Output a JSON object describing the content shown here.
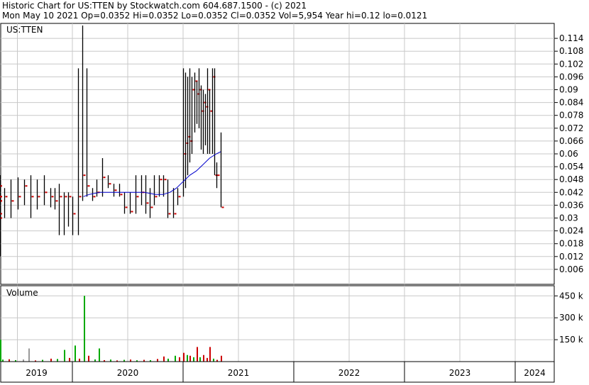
{
  "header": {
    "line1": "Historic Chart for US:TTEN by Stockwatch.com 604.687.1500 - (c) 2021",
    "line2": "Mon May 10 2021   Op=0.0352  Hi=0.0352  Lo=0.0352  Cl=0.0352  Vol=5,954  Year hi=0.12  lo=0.0121"
  },
  "price_panel": {
    "symbol_label": "US:TTEN"
  },
  "volume_panel": {
    "label": "Volume"
  },
  "colors": {
    "price_bar": "#000000",
    "close_tick": "#cc0000",
    "ma_short": "#cc33cc",
    "ma_long": "#0000cc",
    "vol_up": "#00aa00",
    "vol_down": "#cc0000",
    "vol_flat": "#999999",
    "grid": "#c8c8c8"
  },
  "chart_data": [
    {
      "type": "bar",
      "title": "Historic Chart for US:TTEN",
      "series_label": "US:TTEN",
      "ylim": [
        0,
        0.12
      ],
      "y_ticks": [
        "0.114",
        "0.108",
        "0.102",
        "0.096",
        "0.09",
        "0.084",
        "0.078",
        "0.072",
        "0.066",
        "0.06",
        "0.054",
        "0.048",
        "0.042",
        "0.036",
        "0.03",
        "0.024",
        "0.018",
        "0.012",
        "0.006"
      ],
      "x_ticks": [
        "2019",
        "2020",
        "2021",
        "2022",
        "2023",
        "2024"
      ],
      "ohlc": [
        {
          "t": 2018.7,
          "hi": 0.04,
          "lo": 0.022,
          "cl": 0.03
        },
        {
          "t": 2018.73,
          "hi": 0.04,
          "lo": 0.012,
          "cl": 0.038
        },
        {
          "t": 2018.76,
          "hi": 0.04,
          "lo": 0.028,
          "cl": 0.038
        },
        {
          "t": 2018.8,
          "hi": 0.038,
          "lo": 0.03,
          "cl": 0.032
        },
        {
          "t": 2018.84,
          "hi": 0.04,
          "lo": 0.036,
          "cl": 0.038
        },
        {
          "t": 2018.88,
          "hi": 0.046,
          "lo": 0.034,
          "cl": 0.04
        },
        {
          "t": 2018.92,
          "hi": 0.05,
          "lo": 0.03,
          "cl": 0.045
        },
        {
          "t": 2018.96,
          "hi": 0.05,
          "lo": 0.036,
          "cl": 0.04
        },
        {
          "t": 2019.0,
          "hi": 0.05,
          "lo": 0.034,
          "cl": 0.049
        },
        {
          "t": 2019.04,
          "hi": 0.056,
          "lo": 0.046,
          "cl": 0.048
        },
        {
          "t": 2019.08,
          "hi": 0.048,
          "lo": 0.036,
          "cl": 0.04
        },
        {
          "t": 2019.12,
          "hi": 0.046,
          "lo": 0.034,
          "cl": 0.04
        },
        {
          "t": 2019.16,
          "hi": 0.04,
          "lo": 0.034,
          "cl": 0.035
        },
        {
          "t": 2019.2,
          "hi": 0.045,
          "lo": 0.034,
          "cl": 0.042
        },
        {
          "t": 2019.26,
          "hi": 0.046,
          "lo": 0.03,
          "cl": 0.033
        },
        {
          "t": 2019.32,
          "hi": 0.044,
          "lo": 0.036,
          "cl": 0.04
        },
        {
          "t": 2019.38,
          "hi": 0.044,
          "lo": 0.03,
          "cl": 0.04
        },
        {
          "t": 2019.44,
          "hi": 0.048,
          "lo": 0.03,
          "cl": 0.038
        },
        {
          "t": 2019.5,
          "hi": 0.049,
          "lo": 0.034,
          "cl": 0.04
        },
        {
          "t": 2019.56,
          "hi": 0.048,
          "lo": 0.036,
          "cl": 0.045
        },
        {
          "t": 2019.62,
          "hi": 0.05,
          "lo": 0.03,
          "cl": 0.04
        },
        {
          "t": 2019.68,
          "hi": 0.048,
          "lo": 0.034,
          "cl": 0.04
        },
        {
          "t": 2019.74,
          "hi": 0.05,
          "lo": 0.036,
          "cl": 0.042
        },
        {
          "t": 2019.8,
          "hi": 0.044,
          "lo": 0.035,
          "cl": 0.04
        },
        {
          "t": 2019.84,
          "hi": 0.044,
          "lo": 0.034,
          "cl": 0.038
        },
        {
          "t": 2019.88,
          "hi": 0.046,
          "lo": 0.022,
          "cl": 0.04
        },
        {
          "t": 2019.92,
          "hi": 0.042,
          "lo": 0.022,
          "cl": 0.04
        },
        {
          "t": 2019.96,
          "hi": 0.042,
          "lo": 0.026,
          "cl": 0.04
        },
        {
          "t": 2020.0,
          "hi": 0.04,
          "lo": 0.022,
          "cl": 0.032
        },
        {
          "t": 2020.05,
          "hi": 0.1,
          "lo": 0.022,
          "cl": 0.04
        },
        {
          "t": 2020.09,
          "hi": 0.12,
          "lo": 0.038,
          "cl": 0.05
        },
        {
          "t": 2020.13,
          "hi": 0.1,
          "lo": 0.04,
          "cl": 0.045
        },
        {
          "t": 2020.18,
          "hi": 0.044,
          "lo": 0.038,
          "cl": 0.04
        },
        {
          "t": 2020.22,
          "hi": 0.048,
          "lo": 0.04,
          "cl": 0.042
        },
        {
          "t": 2020.27,
          "hi": 0.058,
          "lo": 0.04,
          "cl": 0.049
        },
        {
          "t": 2020.32,
          "hi": 0.05,
          "lo": 0.044,
          "cl": 0.046
        },
        {
          "t": 2020.37,
          "hi": 0.046,
          "lo": 0.04,
          "cl": 0.043
        },
        {
          "t": 2020.42,
          "hi": 0.046,
          "lo": 0.04,
          "cl": 0.041
        },
        {
          "t": 2020.47,
          "hi": 0.042,
          "lo": 0.032,
          "cl": 0.035
        },
        {
          "t": 2020.52,
          "hi": 0.042,
          "lo": 0.032,
          "cl": 0.033
        },
        {
          "t": 2020.57,
          "hi": 0.05,
          "lo": 0.032,
          "cl": 0.04
        },
        {
          "t": 2020.62,
          "hi": 0.05,
          "lo": 0.036,
          "cl": 0.042
        },
        {
          "t": 2020.66,
          "hi": 0.05,
          "lo": 0.032,
          "cl": 0.037
        },
        {
          "t": 2020.7,
          "hi": 0.044,
          "lo": 0.03,
          "cl": 0.035
        },
        {
          "t": 2020.74,
          "hi": 0.05,
          "lo": 0.036,
          "cl": 0.04
        },
        {
          "t": 2020.78,
          "hi": 0.05,
          "lo": 0.04,
          "cl": 0.048
        },
        {
          "t": 2020.82,
          "hi": 0.05,
          "lo": 0.04,
          "cl": 0.048
        },
        {
          "t": 2020.86,
          "hi": 0.048,
          "lo": 0.03,
          "cl": 0.032
        },
        {
          "t": 2020.91,
          "hi": 0.044,
          "lo": 0.03,
          "cl": 0.032
        },
        {
          "t": 2020.95,
          "hi": 0.044,
          "lo": 0.036,
          "cl": 0.04
        },
        {
          "t": 2021.0,
          "hi": 0.1,
          "lo": 0.04,
          "cl": 0.06
        },
        {
          "t": 2021.02,
          "hi": 0.098,
          "lo": 0.044,
          "cl": 0.065
        },
        {
          "t": 2021.04,
          "hi": 0.096,
          "lo": 0.05,
          "cl": 0.068
        },
        {
          "t": 2021.06,
          "hi": 0.1,
          "lo": 0.056,
          "cl": 0.066
        },
        {
          "t": 2021.08,
          "hi": 0.096,
          "lo": 0.06,
          "cl": 0.09
        },
        {
          "t": 2021.1,
          "hi": 0.098,
          "lo": 0.07,
          "cl": 0.094
        },
        {
          "t": 2021.12,
          "hi": 0.094,
          "lo": 0.074,
          "cl": 0.088
        },
        {
          "t": 2021.14,
          "hi": 0.1,
          "lo": 0.072,
          "cl": 0.09
        },
        {
          "t": 2021.16,
          "hi": 0.092,
          "lo": 0.062,
          "cl": 0.08
        },
        {
          "t": 2021.18,
          "hi": 0.09,
          "lo": 0.06,
          "cl": 0.084
        },
        {
          "t": 2021.2,
          "hi": 0.088,
          "lo": 0.064,
          "cl": 0.082
        },
        {
          "t": 2021.22,
          "hi": 0.1,
          "lo": 0.06,
          "cl": 0.09
        },
        {
          "t": 2021.24,
          "hi": 0.09,
          "lo": 0.06,
          "cl": 0.08
        },
        {
          "t": 2021.26,
          "hi": 0.1,
          "lo": 0.06,
          "cl": 0.096
        },
        {
          "t": 2021.28,
          "hi": 0.1,
          "lo": 0.05,
          "cl": 0.05
        },
        {
          "t": 2021.3,
          "hi": 0.056,
          "lo": 0.044,
          "cl": 0.05
        },
        {
          "t": 2021.34,
          "hi": 0.07,
          "lo": 0.035,
          "cl": 0.035
        }
      ],
      "ma_short": [
        {
          "t": 2018.88,
          "v": 0.041
        },
        {
          "t": 2019.0,
          "v": 0.042
        },
        {
          "t": 2019.1,
          "v": 0.044
        },
        {
          "t": 2019.2,
          "v": 0.043
        },
        {
          "t": 2019.3,
          "v": 0.043
        },
        {
          "t": 2019.4,
          "v": 0.04
        },
        {
          "t": 2019.5,
          "v": 0.04
        },
        {
          "t": 2019.6,
          "v": 0.042
        },
        {
          "t": 2019.7,
          "v": 0.042
        },
        {
          "t": 2019.8,
          "v": 0.042
        },
        {
          "t": 2019.9,
          "v": 0.041
        },
        {
          "t": 2020.0,
          "v": 0.039
        },
        {
          "t": 2020.05,
          "v": 0.04
        },
        {
          "t": 2020.1,
          "v": 0.041
        },
        {
          "t": 2020.15,
          "v": 0.043
        },
        {
          "t": 2020.25,
          "v": 0.045
        },
        {
          "t": 2020.35,
          "v": 0.046
        },
        {
          "t": 2020.45,
          "v": 0.046
        },
        {
          "t": 2020.55,
          "v": 0.045
        },
        {
          "t": 2020.65,
          "v": 0.045
        },
        {
          "t": 2020.72,
          "v": 0.044
        },
        {
          "t": 2020.78,
          "v": 0.042
        },
        {
          "t": 2020.82,
          "v": 0.039
        },
        {
          "t": 2020.86,
          "v": 0.043
        },
        {
          "t": 2020.92,
          "v": 0.047
        },
        {
          "t": 2020.98,
          "v": 0.054
        },
        {
          "t": 2021.04,
          "v": 0.064
        },
        {
          "t": 2021.1,
          "v": 0.07
        },
        {
          "t": 2021.14,
          "v": 0.076
        },
        {
          "t": 2021.18,
          "v": 0.079
        },
        {
          "t": 2021.22,
          "v": 0.081
        },
        {
          "t": 2021.26,
          "v": 0.083
        },
        {
          "t": 2021.3,
          "v": 0.082
        },
        {
          "t": 2021.34,
          "v": 0.08
        },
        {
          "t": 2021.36,
          "v": 0.078
        }
      ],
      "ma_long": [
        {
          "t": 2020.1,
          "v": 0.04
        },
        {
          "t": 2020.15,
          "v": 0.041
        },
        {
          "t": 2020.25,
          "v": 0.042
        },
        {
          "t": 2020.35,
          "v": 0.042
        },
        {
          "t": 2020.45,
          "v": 0.042
        },
        {
          "t": 2020.55,
          "v": 0.042
        },
        {
          "t": 2020.65,
          "v": 0.042
        },
        {
          "t": 2020.75,
          "v": 0.041
        },
        {
          "t": 2020.82,
          "v": 0.041
        },
        {
          "t": 2020.88,
          "v": 0.042
        },
        {
          "t": 2020.94,
          "v": 0.044
        },
        {
          "t": 2021.0,
          "v": 0.047
        },
        {
          "t": 2021.06,
          "v": 0.05
        },
        {
          "t": 2021.12,
          "v": 0.052
        },
        {
          "t": 2021.18,
          "v": 0.055
        },
        {
          "t": 2021.24,
          "v": 0.058
        },
        {
          "t": 2021.3,
          "v": 0.06
        },
        {
          "t": 2021.34,
          "v": 0.061
        }
      ]
    },
    {
      "type": "bar",
      "title": "Volume",
      "ylim": [
        0,
        500
      ],
      "y_ticks": [
        "450 k",
        "300 k",
        "150 k"
      ],
      "values_k": [
        {
          "t": 2018.7,
          "v": 70,
          "c": "flat"
        },
        {
          "t": 2018.74,
          "v": 75,
          "c": "down"
        },
        {
          "t": 2018.79,
          "v": 20,
          "c": "down"
        },
        {
          "t": 2018.85,
          "v": 30,
          "c": "down"
        },
        {
          "t": 2018.92,
          "v": 12,
          "c": "up"
        },
        {
          "t": 2018.98,
          "v": 150,
          "c": "up"
        },
        {
          "t": 2019.05,
          "v": 10,
          "c": "down"
        },
        {
          "t": 2019.11,
          "v": 15,
          "c": "up"
        },
        {
          "t": 2019.18,
          "v": 18,
          "c": "down"
        },
        {
          "t": 2019.25,
          "v": 10,
          "c": "up"
        },
        {
          "t": 2019.3,
          "v": 18,
          "c": "down"
        },
        {
          "t": 2019.36,
          "v": 14,
          "c": "up"
        },
        {
          "t": 2019.42,
          "v": 16,
          "c": "down"
        },
        {
          "t": 2019.48,
          "v": 10,
          "c": "up"
        },
        {
          "t": 2019.55,
          "v": 15,
          "c": "flat"
        },
        {
          "t": 2019.6,
          "v": 90,
          "c": "flat"
        },
        {
          "t": 2019.66,
          "v": 8,
          "c": "down"
        },
        {
          "t": 2019.72,
          "v": 12,
          "c": "up"
        },
        {
          "t": 2019.8,
          "v": 20,
          "c": "down"
        },
        {
          "t": 2019.86,
          "v": 18,
          "c": "up"
        },
        {
          "t": 2019.92,
          "v": 80,
          "c": "up"
        },
        {
          "t": 2019.97,
          "v": 25,
          "c": "down"
        },
        {
          "t": 2020.02,
          "v": 110,
          "c": "up"
        },
        {
          "t": 2020.06,
          "v": 20,
          "c": "down"
        },
        {
          "t": 2020.1,
          "v": 450,
          "c": "up"
        },
        {
          "t": 2020.14,
          "v": 40,
          "c": "down"
        },
        {
          "t": 2020.2,
          "v": 15,
          "c": "up"
        },
        {
          "t": 2020.24,
          "v": 90,
          "c": "up"
        },
        {
          "t": 2020.28,
          "v": 10,
          "c": "down"
        },
        {
          "t": 2020.34,
          "v": 14,
          "c": "up"
        },
        {
          "t": 2020.4,
          "v": 8,
          "c": "down"
        },
        {
          "t": 2020.46,
          "v": 12,
          "c": "up"
        },
        {
          "t": 2020.52,
          "v": 14,
          "c": "down"
        },
        {
          "t": 2020.58,
          "v": 9,
          "c": "up"
        },
        {
          "t": 2020.64,
          "v": 12,
          "c": "down"
        },
        {
          "t": 2020.7,
          "v": 10,
          "c": "up"
        },
        {
          "t": 2020.76,
          "v": 18,
          "c": "down"
        },
        {
          "t": 2020.82,
          "v": 35,
          "c": "down"
        },
        {
          "t": 2020.86,
          "v": 20,
          "c": "up"
        },
        {
          "t": 2020.92,
          "v": 40,
          "c": "up"
        },
        {
          "t": 2020.96,
          "v": 30,
          "c": "down"
        },
        {
          "t": 2021.0,
          "v": 60,
          "c": "down"
        },
        {
          "t": 2021.03,
          "v": 45,
          "c": "up"
        },
        {
          "t": 2021.06,
          "v": 40,
          "c": "down"
        },
        {
          "t": 2021.09,
          "v": 30,
          "c": "up"
        },
        {
          "t": 2021.12,
          "v": 100,
          "c": "down"
        },
        {
          "t": 2021.15,
          "v": 30,
          "c": "up"
        },
        {
          "t": 2021.18,
          "v": 45,
          "c": "down"
        },
        {
          "t": 2021.21,
          "v": 25,
          "c": "down"
        },
        {
          "t": 2021.24,
          "v": 100,
          "c": "down"
        },
        {
          "t": 2021.27,
          "v": 20,
          "c": "up"
        },
        {
          "t": 2021.3,
          "v": 12,
          "c": "down"
        },
        {
          "t": 2021.34,
          "v": 40,
          "c": "down"
        }
      ]
    }
  ]
}
